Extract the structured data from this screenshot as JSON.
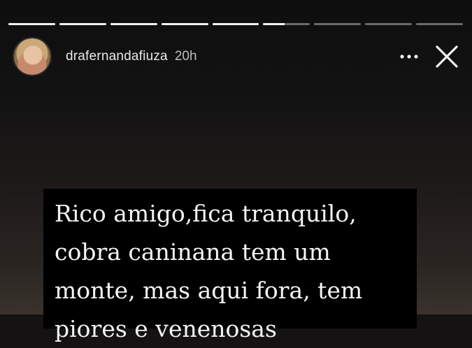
{
  "story": {
    "progress_segments": [
      {
        "fill": 1
      },
      {
        "fill": 1
      },
      {
        "fill": 1
      },
      {
        "fill": 1
      },
      {
        "fill": 1
      },
      {
        "fill": 0.45
      },
      {
        "fill": 0
      },
      {
        "fill": 0
      },
      {
        "fill": 0
      }
    ],
    "header": {
      "username": "drafernandafiuza",
      "time": "20h",
      "more_icon": "more-horizontal-icon",
      "close_icon": "close-icon"
    },
    "text_lines": [
      "Rico amigo,fica tranquilo,",
      "cobra caninana tem um",
      "monte, mas aqui fora, tem",
      "piores e venenosas"
    ],
    "colors": {
      "text": "#f4f4f4",
      "text_background": "#000000",
      "progress_active": "#f2f2f2"
    }
  }
}
